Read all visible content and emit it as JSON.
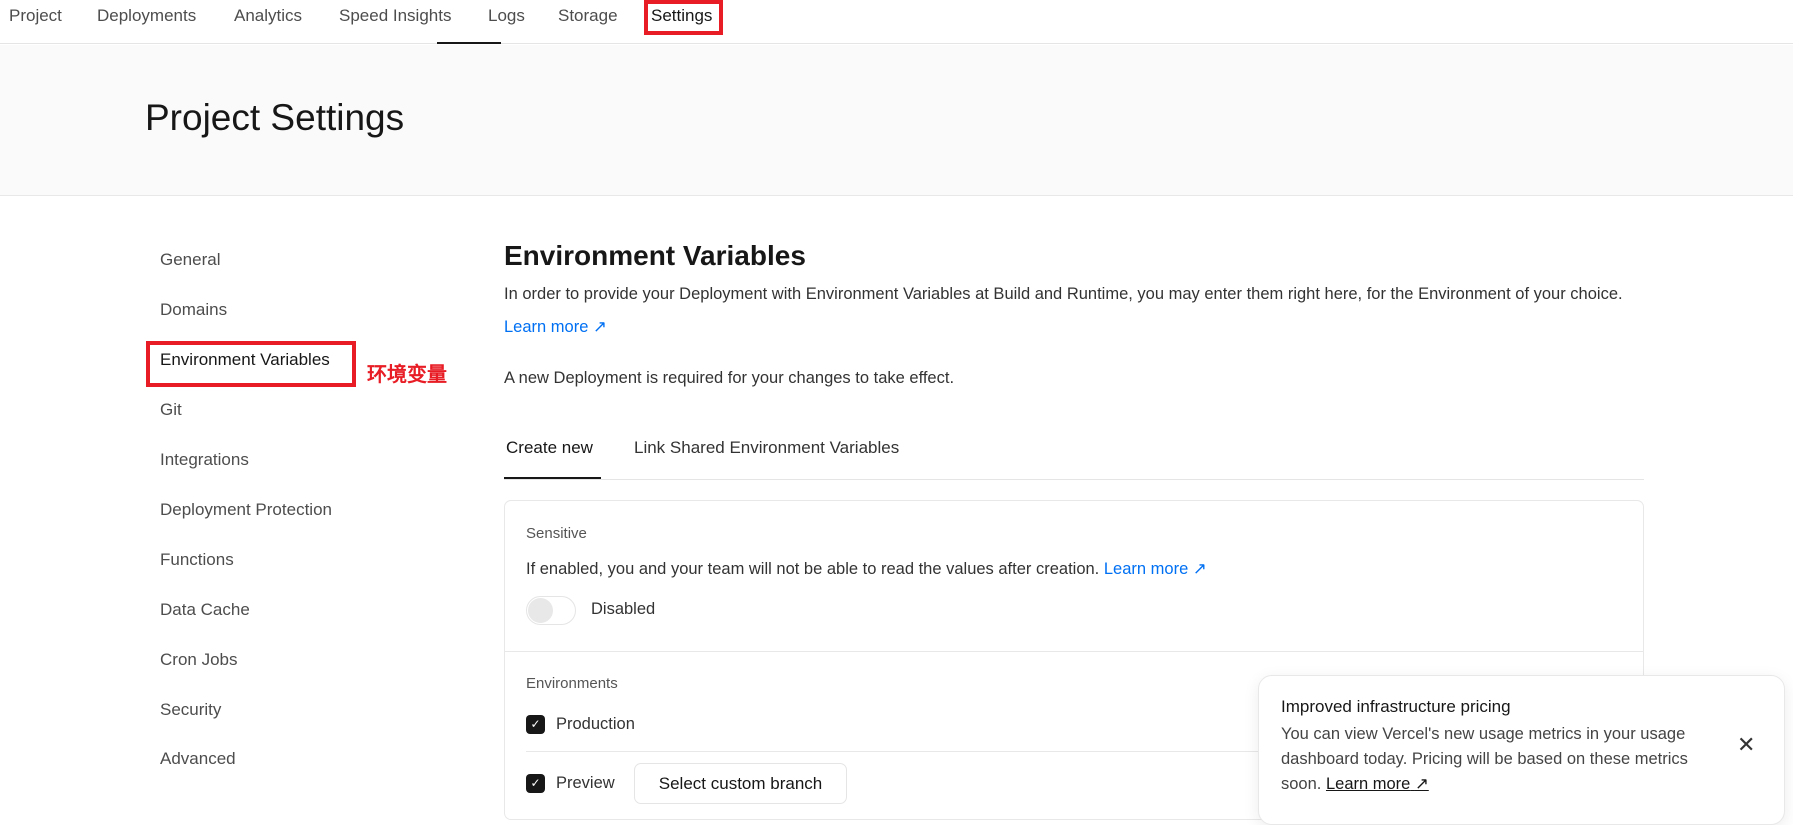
{
  "nav": {
    "items": [
      "Project",
      "Deployments",
      "Analytics",
      "Speed Insights",
      "Logs",
      "Storage",
      "Settings"
    ]
  },
  "header": {
    "title": "Project Settings"
  },
  "sidebar": {
    "items": [
      "General",
      "Domains",
      "Environment Variables",
      "Git",
      "Integrations",
      "Deployment Protection",
      "Functions",
      "Data Cache",
      "Cron Jobs",
      "Security",
      "Advanced"
    ]
  },
  "annotation": {
    "label": "环境变量"
  },
  "main": {
    "title": "Environment Variables",
    "description": "In order to provide your Deployment with Environment Variables at Build and Runtime, you may enter them right here, for the Environment of your choice.",
    "learn_more": "Learn more",
    "notice": "A new Deployment is required for your changes to take effect.",
    "tabs": [
      "Create new",
      "Link Shared Environment Variables"
    ],
    "sensitive": {
      "label": "Sensitive",
      "text": "If enabled, you and your team will not be able to read the values after creation.",
      "learn_more": "Learn more",
      "toggle_state": "Disabled"
    },
    "environments": {
      "label": "Environments",
      "production": "Production",
      "preview": "Preview",
      "branch_button": "Select custom branch"
    }
  },
  "toast": {
    "title": "Improved infrastructure pricing",
    "body": "You can view Vercel's new usage metrics in your usage dashboard today. Pricing will be based on these metrics soon.",
    "learn_more": "Learn more"
  }
}
